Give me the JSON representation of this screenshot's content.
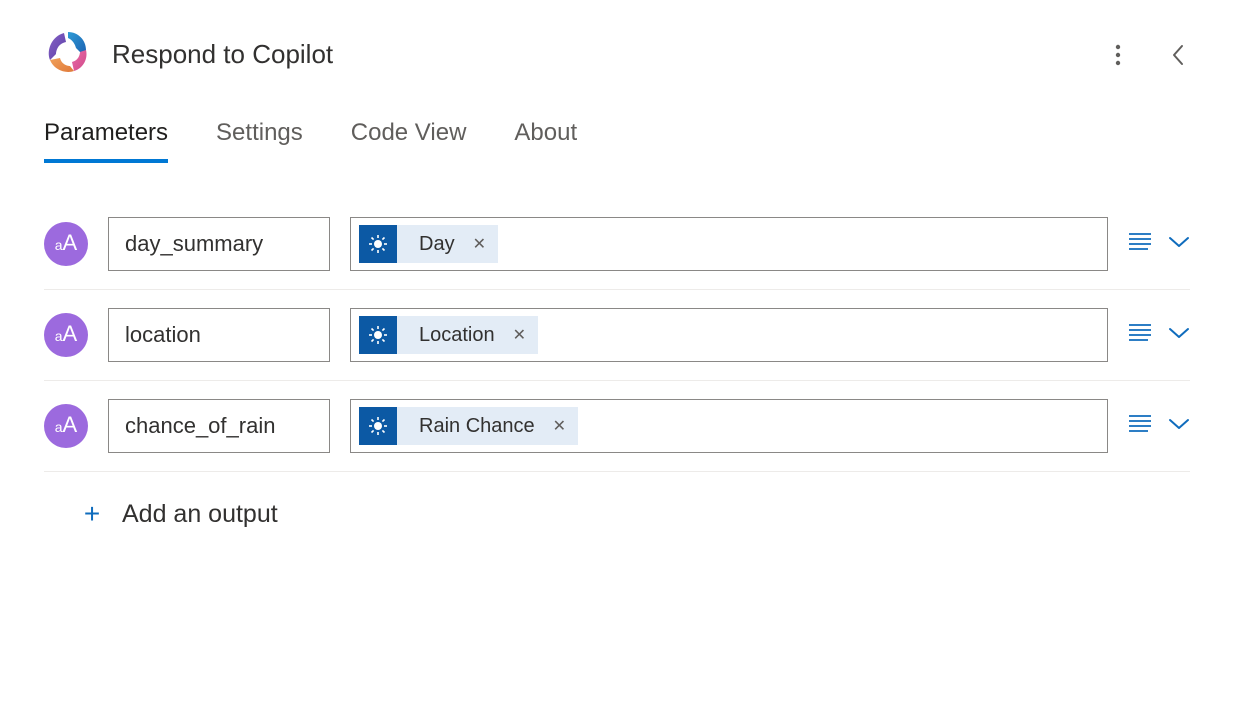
{
  "header": {
    "title": "Respond to Copilot"
  },
  "tabs": {
    "parameters": "Parameters",
    "settings": "Settings",
    "codeview": "Code View",
    "about": "About"
  },
  "parameters": [
    {
      "name": "day_summary",
      "token": "Day"
    },
    {
      "name": "location",
      "token": "Location"
    },
    {
      "name": "chance_of_rain",
      "token": "Rain Chance"
    }
  ],
  "add_output_label": "Add an output"
}
